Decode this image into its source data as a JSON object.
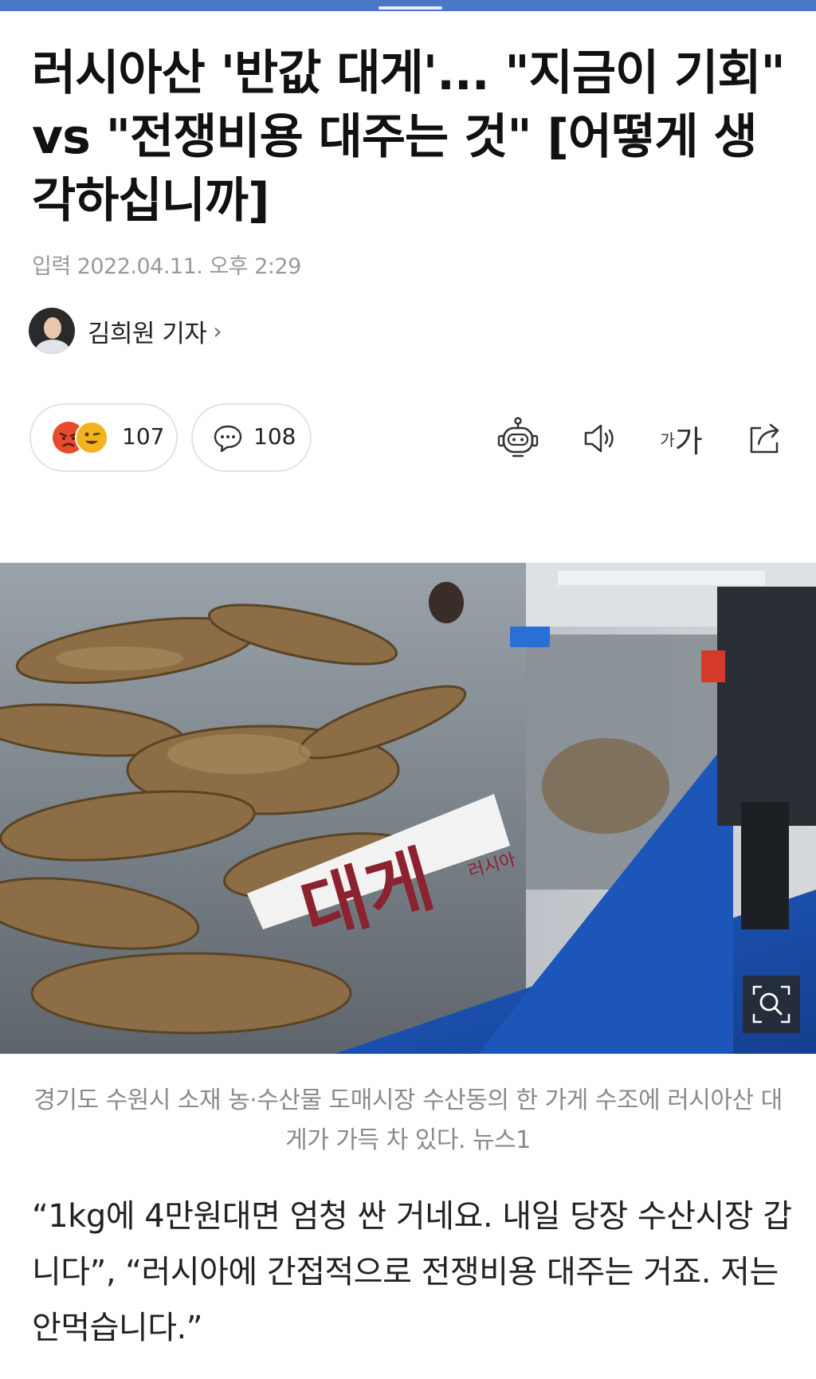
{
  "article": {
    "headline": "러시아산 '반값 대게'... \"지금이 기회\" vs \"전쟁비용 대주는 것\" [어떻게 생각하십니까]",
    "date_label": "입력",
    "date_value": "2022.04.11. 오후 2:29",
    "author": {
      "name": "김희원 기자",
      "chevron": "›"
    },
    "reactions": {
      "count": "107",
      "icons": [
        "angry-emoji",
        "smile-emoji"
      ]
    },
    "comments": {
      "count": "108"
    },
    "tools": {
      "font_size_small": "가",
      "font_size_large": "가"
    },
    "photo": {
      "sign_text": "대게",
      "sign_small_text": "러시아"
    },
    "caption": "경기도 수원시 소재 농·수산물 도매시장 수산동의 한 가게 수조에 러시아산 대게가 가득 차 있다. 뉴스1",
    "body_paragraph": "“1kg에 4만원대면 엄청 싼 거네요. 내일 당장 수산시장 갑니다”, “러시아에 간접적으로 전쟁비용 대주는 거죠. 저는 안먹습니다.”"
  },
  "colors": {
    "top_bar": "#4a78c4",
    "angry_emoji": "#e84a2e",
    "smile_emoji": "#f4b21e",
    "tank_blue": "#1f5fc8"
  }
}
